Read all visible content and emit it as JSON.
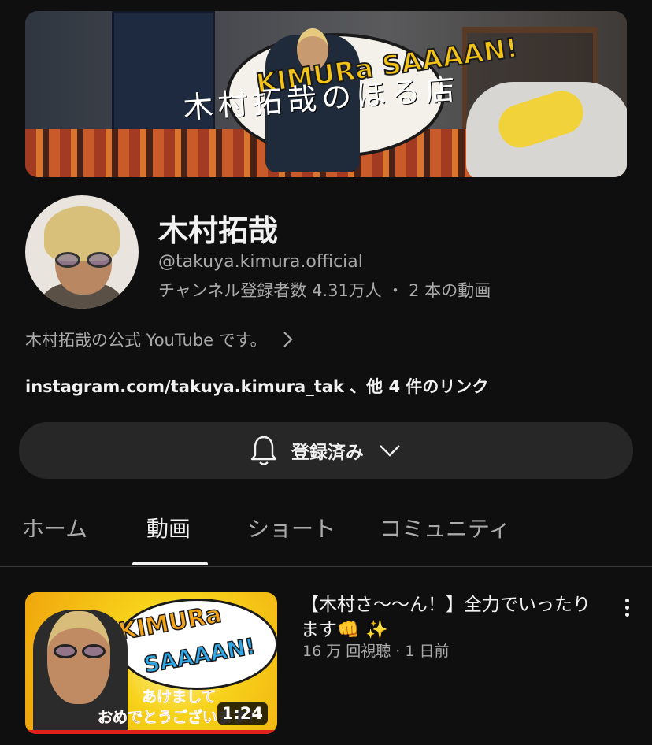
{
  "channel": {
    "banner": {
      "script_text": "木村拓哉のほる店",
      "logo_text": "KIMURa SAAAAN!"
    },
    "name": "木村拓哉",
    "handle": "@takuya.kimura.official",
    "stats": "チャンネル登録者数 4.31万人 ・ 2 本の動画",
    "description": "木村拓哉の公式 YouTube です。",
    "links": "instagram.com/takuya.kimura_tak 、他 4 件のリンク"
  },
  "subscribe": {
    "label": "登録済み",
    "bell_icon": "bell-icon",
    "chevron_icon": "chevron-down-icon"
  },
  "tabs": [
    {
      "label": "ホーム",
      "active": false
    },
    {
      "label": "動画",
      "active": true
    },
    {
      "label": "ショート",
      "active": false
    },
    {
      "label": "コミュニティ",
      "active": false
    }
  ],
  "videos": [
    {
      "title": "【木村さ〜〜ん！】全力でいったります👊 ✨",
      "meta": "16 万 回視聴 · 1 日前",
      "duration": "1:24",
      "thumb_text_1": "KIMURa",
      "thumb_text_2": "SAAAAN!",
      "thumb_text_3": "あけまして",
      "thumb_text_4": "おめでとうございます！"
    }
  ],
  "colors": {
    "background": "#0f0f0f",
    "text_primary": "#f1f1f1",
    "text_secondary": "#aaaaaa",
    "button_bg": "#272727",
    "progress": "#e0201a"
  }
}
